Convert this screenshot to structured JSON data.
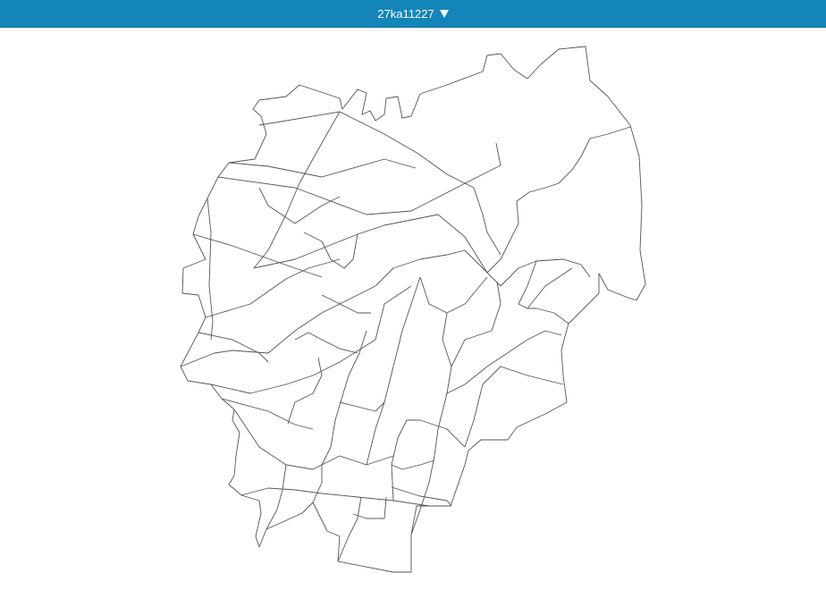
{
  "header": {
    "title": "27ka11227",
    "dropdown_icon": "caret-down-icon"
  },
  "map": {
    "outline_color": "#555555",
    "background": "#ffffff",
    "bar_color": "#1385b9"
  }
}
